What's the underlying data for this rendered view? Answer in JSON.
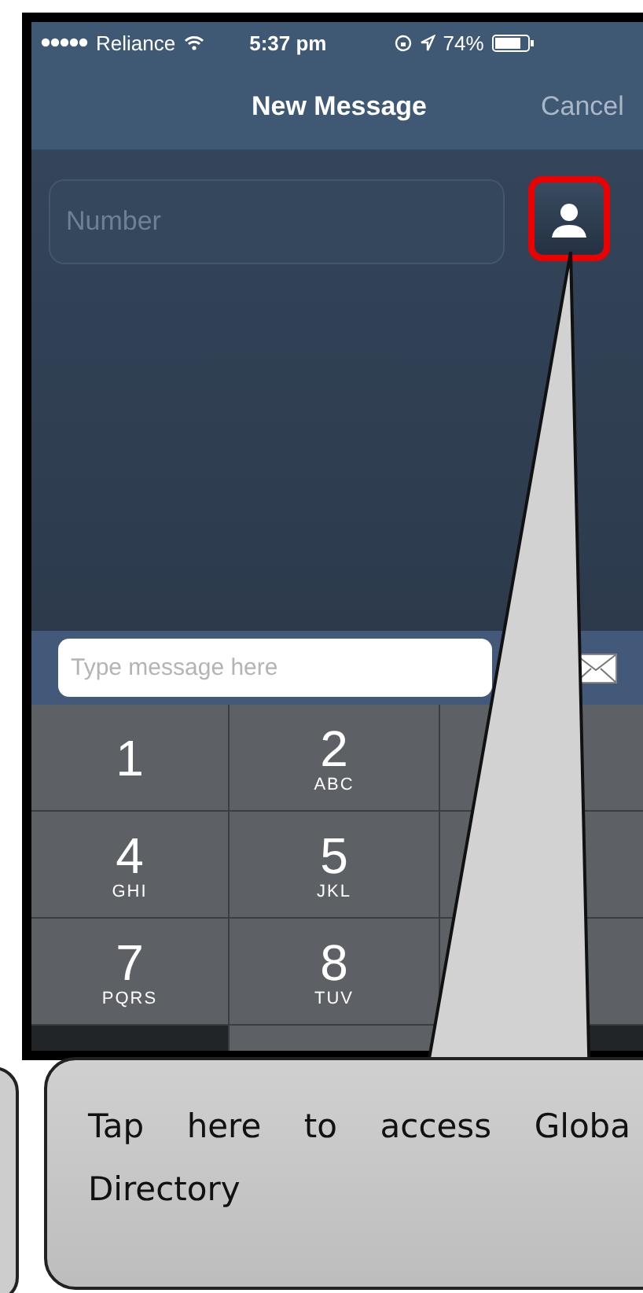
{
  "status_bar": {
    "carrier": "Reliance",
    "time": "5:37 pm",
    "battery": "74%"
  },
  "nav": {
    "title": "New Message",
    "action": "Cancel"
  },
  "recipient": {
    "placeholder": "Number"
  },
  "composer": {
    "placeholder": "Type message here"
  },
  "keypad": [
    {
      "kind": "digit",
      "digit": "1"
    },
    {
      "kind": "digit",
      "digit": "2",
      "letters": "ABC"
    },
    {
      "kind": "blank"
    },
    {
      "kind": "digit",
      "digit": "4",
      "letters": "GHI"
    },
    {
      "kind": "digit",
      "digit": "5",
      "letters": "JKL"
    },
    {
      "kind": "blank"
    },
    {
      "kind": "digit",
      "digit": "7",
      "letters": "PQRS"
    },
    {
      "kind": "digit",
      "digit": "8",
      "letters": "TUV"
    },
    {
      "kind": "blank"
    },
    {
      "kind": "dark"
    },
    {
      "kind": "blank"
    },
    {
      "kind": "dark"
    }
  ],
  "callout": {
    "text": "Tap here to access Globa Directory"
  }
}
